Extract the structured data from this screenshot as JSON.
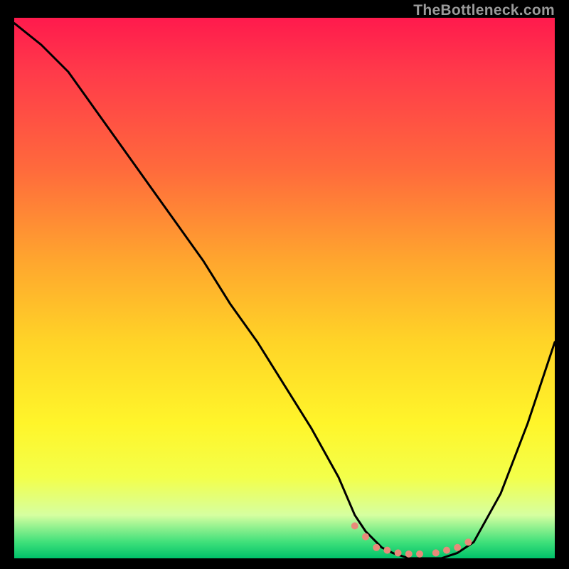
{
  "watermark": "TheBottleneck.com",
  "chart_data": {
    "type": "line",
    "title": "",
    "xlabel": "",
    "ylabel": "",
    "xlim": [
      0,
      100
    ],
    "ylim": [
      0,
      100
    ],
    "series": [
      {
        "name": "bottleneck-curve",
        "x": [
          0,
          5,
          10,
          15,
          20,
          25,
          30,
          35,
          40,
          45,
          50,
          55,
          60,
          63,
          65,
          68,
          70,
          73,
          76,
          79,
          82,
          85,
          90,
          95,
          100
        ],
        "y": [
          99,
          95,
          90,
          83,
          76,
          69,
          62,
          55,
          47,
          40,
          32,
          24,
          15,
          8,
          5,
          2,
          1,
          0,
          0,
          0,
          1,
          3,
          12,
          25,
          40
        ]
      }
    ],
    "markers": {
      "name": "highlight-dots",
      "color": "#e88a7a",
      "x": [
        63,
        65,
        67,
        69,
        71,
        73,
        75,
        78,
        80,
        82,
        84
      ],
      "y": [
        6,
        4,
        2,
        1.5,
        1,
        0.8,
        0.8,
        1,
        1.5,
        2,
        3
      ]
    },
    "background": "vertical-gradient red→orange→yellow→green"
  }
}
